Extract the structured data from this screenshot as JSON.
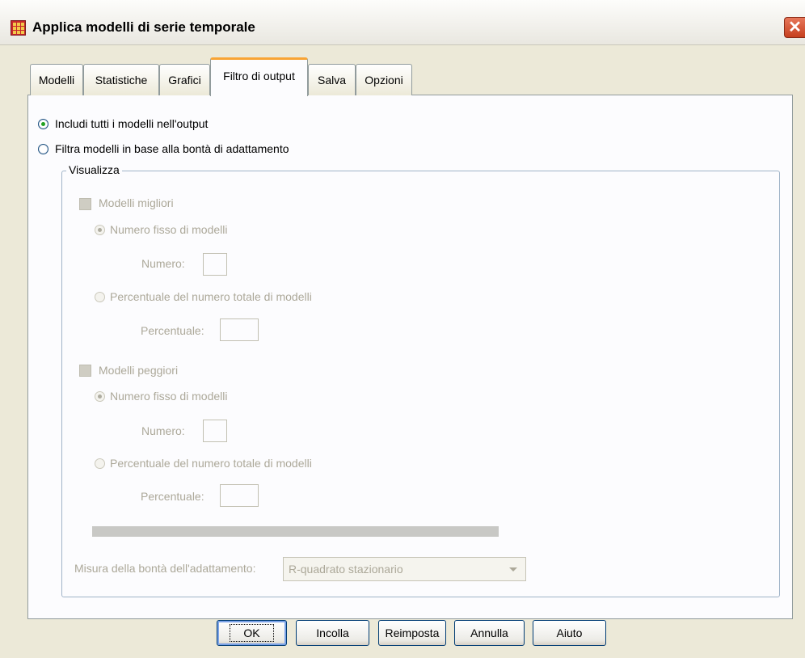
{
  "window": {
    "title": "Applica modelli di serie temporale",
    "close_glyph": "✕"
  },
  "tabs": [
    {
      "label": "Modelli"
    },
    {
      "label": "Statistiche"
    },
    {
      "label": "Grafici"
    },
    {
      "label": "Filtro di output",
      "active": true
    },
    {
      "label": "Salva"
    },
    {
      "label": "Opzioni"
    }
  ],
  "filter": {
    "include_all_label": "Includi tutti i modelli nell'output",
    "include_all_checked": true,
    "filter_by_fit_label": "Filtra modelli in base alla bontà di adattamento",
    "filter_by_fit_checked": false
  },
  "display_group": {
    "legend": "Visualizza",
    "best": {
      "checkbox_label": "Modelli migliori",
      "fixed_label": "Numero fisso di modelli",
      "number_label": "Numero:",
      "number_value": "",
      "percent_option_label": "Percentuale del numero totale di modelli",
      "percent_label": "Percentuale:",
      "percent_value": ""
    },
    "worst": {
      "checkbox_label": "Modelli peggiori",
      "fixed_label": "Numero fisso di modelli",
      "number_label": "Numero:",
      "number_value": "",
      "percent_option_label": "Percentuale del numero totale di modelli",
      "percent_label": "Percentuale:",
      "percent_value": ""
    },
    "fit_measure_label": "Misura della bontà dell'adattamento:",
    "fit_measure_value": "R-quadrato stazionario"
  },
  "buttons": {
    "ok": "OK",
    "paste": "Incolla",
    "reset": "Reimposta",
    "cancel": "Annulla",
    "help": "Aiuto"
  },
  "colors": {
    "tab_highlight": "#f8a434",
    "radio_selected": "#21a121",
    "disabled_text": "#aca899"
  }
}
